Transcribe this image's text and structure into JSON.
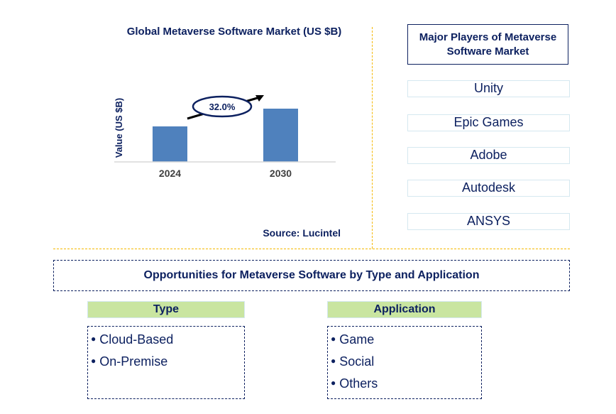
{
  "chart_data": {
    "type": "bar",
    "title": "Global Metaverse Software Market (US $B)",
    "categories": [
      "2024",
      "2030"
    ],
    "values": [
      2,
      3
    ],
    "values_note": "relative bar heights only; no numeric axis shown",
    "xlabel": "",
    "ylabel": "Value (US $B)",
    "ylim": [
      0,
      3
    ],
    "grid": false,
    "bar_color": "#4f81bd",
    "annotation": {
      "label": "32.0%",
      "type": "growth-arrow"
    }
  },
  "source": "Source: Lucintel",
  "players": {
    "header": "Major Players of Metaverse Software Market",
    "items": [
      "Unity",
      "Epic Games",
      "Adobe",
      "Autodesk",
      "ANSYS"
    ]
  },
  "opportunities": {
    "title": "Opportunities for Metaverse Software by Type and Application",
    "segments": [
      {
        "header": "Type",
        "items": [
          "Cloud-Based",
          "On-Premise"
        ]
      },
      {
        "header": "Application",
        "items": [
          "Game",
          "Social",
          "Others"
        ]
      }
    ]
  },
  "colors": {
    "navy": "#0d2160",
    "separator": "#f5b800",
    "segment_header_bg": "#c9e5a0",
    "bar": "#4f81bd"
  }
}
